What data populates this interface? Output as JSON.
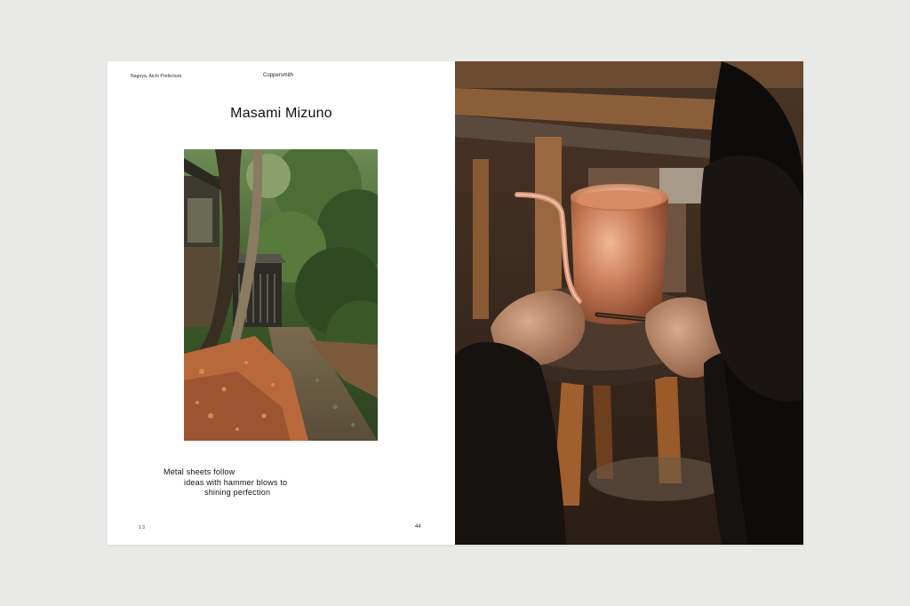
{
  "left_page": {
    "running_location": "Nagoya, Aichi Prefecture",
    "running_section": "Coppersmith",
    "title": "Masami Mizuno",
    "pullquote": {
      "line_1": "Metal sheets follow",
      "line_2": "ideas with hammer blows to",
      "line_3": "shining perfection"
    },
    "folio_left": "1  3",
    "page_number": "44"
  },
  "colors": {
    "background": "#e9e9e7",
    "page": "#ffffff",
    "copper": "#c77a55",
    "foliage": "#3f5a2c",
    "leaves": "#b8683b"
  },
  "images": {
    "left": "garden-path-photo",
    "right": "coppersmith-hands-photo"
  }
}
